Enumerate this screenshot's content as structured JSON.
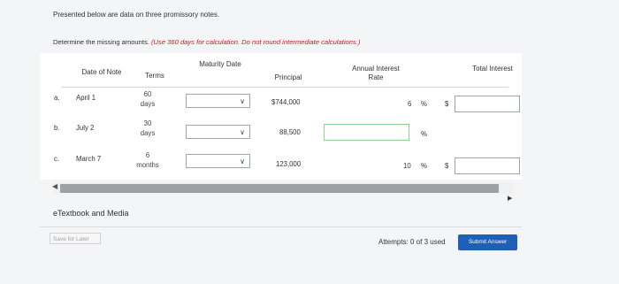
{
  "intro": "Presented below are data on three promissory notes.",
  "instruction_plain": "Determine the missing amounts.",
  "instruction_red": "(Use 360 days for calculation. Do not round intermediate calculations.)",
  "headers": {
    "date_of_note": "Date of Note",
    "terms": "Terms",
    "maturity_date": "Maturity Date",
    "principal": "Principal",
    "annual_rate": "Annual Interest Rate",
    "total_interest": "Total Interest"
  },
  "rows": [
    {
      "letter": "a.",
      "date": "April 1",
      "terms_num": "60",
      "terms_unit": "days",
      "principal": "$744,000",
      "rate": "6",
      "rate_symbol": "%",
      "dollar": "$"
    },
    {
      "letter": "b.",
      "date": "July 2",
      "terms_num": "30",
      "terms_unit": "days",
      "principal": "88,500",
      "rate": "",
      "rate_symbol": "%",
      "dollar": ""
    },
    {
      "letter": "c.",
      "date": "March 7",
      "terms_num": "6",
      "terms_unit": "months",
      "principal": "123,000",
      "rate": "10",
      "rate_symbol": "%",
      "dollar": "$"
    }
  ],
  "etextbook": "eTextbook and Media",
  "save_label": "Save for Later",
  "attempts": "Attempts: 0 of 3 used",
  "submit_label": "Submit Answer",
  "colors": {
    "instruction_red": "#d01b1b",
    "submit_blue": "#1f5fb5"
  }
}
